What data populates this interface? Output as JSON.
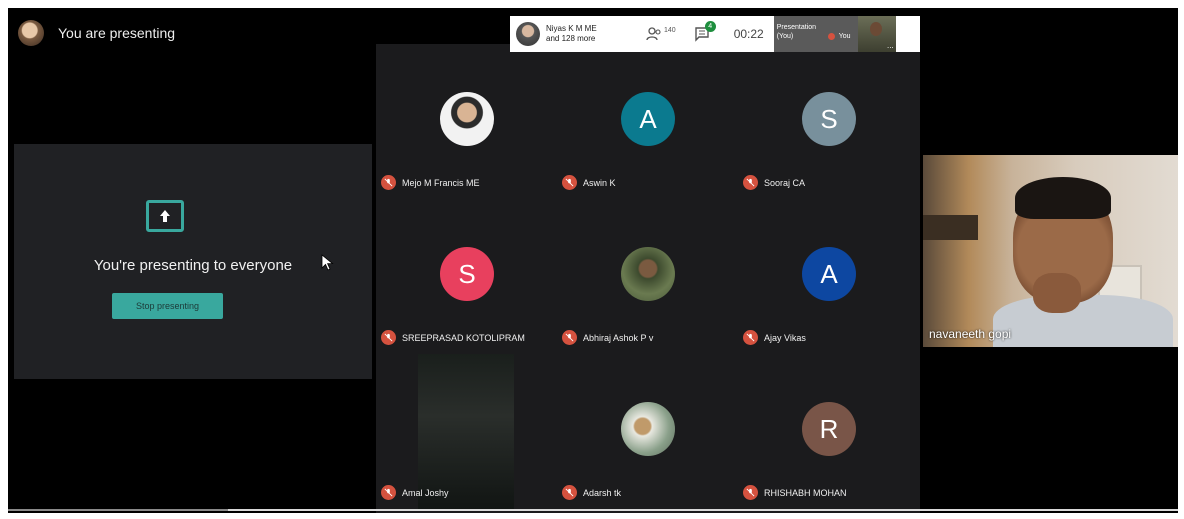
{
  "header": {
    "status_text": "You are presenting"
  },
  "present_panel": {
    "title": "You're presenting to everyone",
    "stop_button": "Stop presenting"
  },
  "meeting_bar": {
    "presenter_line1": "Niyas K M ME",
    "presenter_line2": "and 128 more",
    "participants_count": "140",
    "chat_badge": "4",
    "timer": "00:22",
    "presentation_label_line1": "Presentation",
    "presentation_label_line2": "(You)",
    "you_label": "You",
    "more_label": "..."
  },
  "participants": [
    {
      "name": "Mejo M Francis ME",
      "avatar": "photo",
      "color": "#ffffff"
    },
    {
      "name": "Aswin K",
      "avatar": "A",
      "color": "#0b7a8f"
    },
    {
      "name": "Sooraj CA",
      "avatar": "S",
      "color": "#78909c"
    },
    {
      "name": "SREEPRASAD KOTOLIPRAM",
      "avatar": "S",
      "color": "#e8405e"
    },
    {
      "name": "Abhiraj Ashok P v",
      "avatar": "photo",
      "color": "#4a5a3a"
    },
    {
      "name": "Ajay Vikas",
      "avatar": "A",
      "color": "#0d47a1"
    },
    {
      "name": "Amal Joshy",
      "avatar": "video",
      "color": "#1a1f1c"
    },
    {
      "name": "Adarsh tk",
      "avatar": "photo",
      "color": "#8aa08a"
    },
    {
      "name": "RHISHABH MOHAN",
      "avatar": "R",
      "color": "#795548"
    }
  ],
  "self_view": {
    "name": "navaneeth gopi"
  },
  "colors": {
    "accent": "#39a89e",
    "mic_muted": "#d5523f",
    "panel_bg": "#202124"
  },
  "icons": {
    "present": "present-screen-icon",
    "mic": "mic-off-icon",
    "people": "people-icon",
    "chat": "chat-icon"
  }
}
